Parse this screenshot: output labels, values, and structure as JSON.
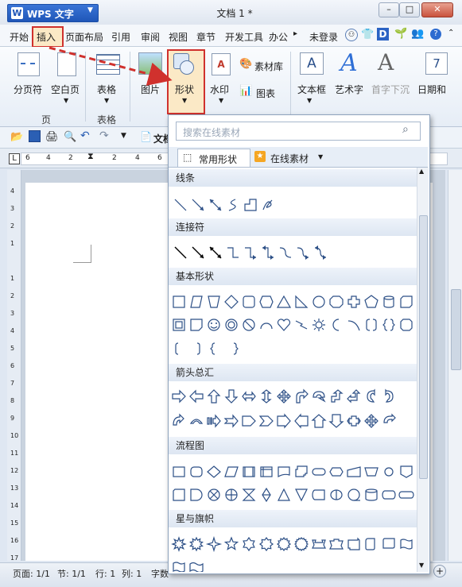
{
  "app": {
    "name": "WPS 文字",
    "doc_title": "文档 1 *"
  },
  "menu_tabs": [
    "开始",
    "插入",
    "页面布局",
    "引用",
    "审阅",
    "视图",
    "章节",
    "开发工具",
    "办公"
  ],
  "menu_right": {
    "login": "未登录"
  },
  "ribbon": {
    "page_break": "分页符",
    "blank_page": "空白页",
    "group_page": "页",
    "table": "表格",
    "group_table": "表格",
    "picture": "图片",
    "shapes": "形状",
    "watermark": "水印",
    "material": "素材库",
    "chart": "图表",
    "textbox": "文本框",
    "wordart": "艺术字",
    "dropcap": "首字下沉",
    "datetime": "日期和"
  },
  "qat": {
    "doc_tab": "文档"
  },
  "ruler": {
    "ticks": [
      "6",
      "4",
      "2",
      "",
      "2",
      "4",
      "6"
    ]
  },
  "vruler_ticks": [
    "4",
    "3",
    "2",
    "1",
    "",
    "1",
    "2",
    "3",
    "4",
    "5",
    "6",
    "7",
    "8",
    "9",
    "10",
    "11",
    "12",
    "13",
    "14",
    "15",
    "16",
    "17"
  ],
  "status": {
    "page": "页面: 1/1",
    "section": "节: 1/1",
    "line": "行: 1",
    "col": "列: 1",
    "words": "字数"
  },
  "shape_panel": {
    "search_placeholder": "搜索在线素材",
    "tab_common": "常用形状",
    "tab_online": "在线素材",
    "sections": [
      "线条",
      "连接符",
      "基本形状",
      "箭头总汇",
      "流程图",
      "星与旗帜"
    ]
  },
  "colors": {
    "accent": "#1f56b8",
    "highlight": "#d0312d",
    "hover": "#fbe9c6"
  }
}
